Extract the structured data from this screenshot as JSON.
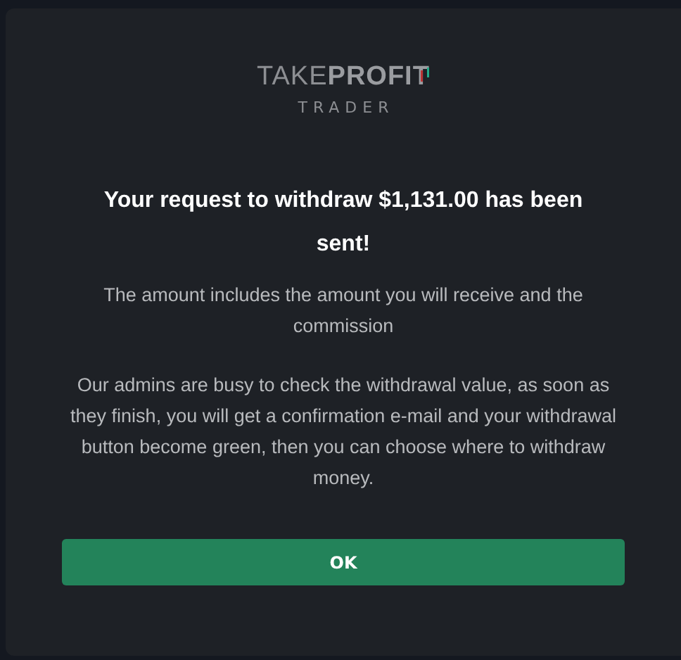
{
  "logo": {
    "brand": "TAKE**PROFIT**",
    "sub": "TRADER"
  },
  "title": "Your request to withdraw $1,131.00 has been sent!",
  "paragraphs": [
    "The amount includes the amount you will receive and the commission",
    "Our admins are busy to check the withdrawal value, as soon as they finish, you will get a confirmation e-mail and your withdrawal button become green, then you can choose where to withdraw money."
  ],
  "buttons": [
    "OK"
  ]
}
